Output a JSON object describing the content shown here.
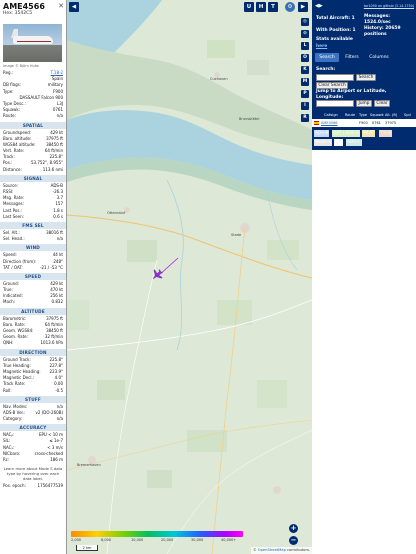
{
  "aircraft": {
    "callsign": "AME4566",
    "hex_label": "Hex: 3542C5",
    "close": "✕",
    "photo_credit": "Image © Björn Huke",
    "info_rows": [
      {
        "k": "Reg.:",
        "v": "T.18-2",
        "link": true
      },
      {
        "k": "",
        "v": "Spain"
      },
      {
        "k": "DB flags:",
        "v": "military"
      },
      {
        "k": "Type:",
        "v": "F900"
      },
      {
        "k": "",
        "v": "DASSAULT Falcon 900"
      },
      {
        "k": "Type Desc.:",
        "v": "L3J"
      },
      {
        "k": "Squawk:",
        "v": "0761"
      },
      {
        "k": "Route:",
        "v": "n/a"
      }
    ]
  },
  "sections": [
    {
      "title": "SPATIAL",
      "rows": [
        {
          "k": "Groundspeed:",
          "v": "429 kt"
        },
        {
          "k": "Baro. altitude:",
          "v": "37975 ft"
        },
        {
          "k": "WGS84 altitude:",
          "v": "38450 ft"
        },
        {
          "k": "Vert. Rate:",
          "v": "64 ft/min"
        },
        {
          "k": "Track:",
          "v": "225.8°"
        },
        {
          "k": "Pos.:",
          "v": "53.752°, 8.955°"
        },
        {
          "k": "Distance:",
          "v": "113.6 nmi"
        }
      ]
    },
    {
      "title": "SIGNAL",
      "rows": [
        {
          "k": "Source:",
          "v": "ADS-B"
        },
        {
          "k": "RSSI:",
          "v": "-26.3"
        },
        {
          "k": "Msg. Rate:",
          "v": "3.7"
        },
        {
          "k": "Messages:",
          "v": "157"
        },
        {
          "k": "Last Pos.:",
          "v": "1.8 s"
        },
        {
          "k": "Last Seen:",
          "v": "0.6 s"
        }
      ]
    },
    {
      "title": "FMS SEL",
      "rows": [
        {
          "k": "Sel. Alt.:",
          "v": "38016 ft"
        },
        {
          "k": "Sel. Head.:",
          "v": "n/a"
        }
      ]
    },
    {
      "title": "WIND",
      "rows": [
        {
          "k": "Speed:",
          "v": "44 kt"
        },
        {
          "k": "Direction (from):",
          "v": "248°"
        },
        {
          "k": "TAT / OAT:",
          "v": "-21 / -53 °C"
        }
      ]
    },
    {
      "title": "SPEED",
      "rows": [
        {
          "k": "Ground:",
          "v": "429 kt"
        },
        {
          "k": "True:",
          "v": "470 kt"
        },
        {
          "k": "Indicated:",
          "v": "256 kt"
        },
        {
          "k": "Mach:",
          "v": "0.832"
        }
      ]
    },
    {
      "title": "ALTITUDE",
      "rows": [
        {
          "k": "Barometric:",
          "v": "37975 ft"
        },
        {
          "k": "Baro. Rate:",
          "v": "64 ft/min"
        },
        {
          "k": "Geom. WGS84:",
          "v": "38450 ft"
        },
        {
          "k": "Geom. Rate:",
          "v": "32 ft/min"
        },
        {
          "k": "QNH:",
          "v": "1013.6 hPa"
        }
      ]
    },
    {
      "title": "DIRECTION",
      "rows": [
        {
          "k": "Ground Track:",
          "v": "225.8°"
        },
        {
          "k": "True Heading:",
          "v": "227.8°"
        },
        {
          "k": "Magnetic Heading:",
          "v": "223.9°"
        },
        {
          "k": "Magnetic Decl.:",
          "v": "4.0°"
        },
        {
          "k": "Track Rate:",
          "v": "0.00"
        },
        {
          "k": "Roll:",
          "v": "-0.5"
        }
      ]
    },
    {
      "title": "STUFF",
      "rows": [
        {
          "k": "Nav. Modes:",
          "v": "n/a"
        },
        {
          "k": "ADS-B Ver.:",
          "v": "v2 (DO-260B)"
        },
        {
          "k": "Category:",
          "v": "n/a"
        }
      ]
    },
    {
      "title": "ACCURACY",
      "rows": [
        {
          "k": "NACₚ:",
          "v": "EPU < 10 m"
        },
        {
          "k": "SIL:",
          "v": "≤ 1e-7"
        },
        {
          "k": "NACᵥ:",
          "v": "< 3 m/s"
        },
        {
          "k": "NICbaro:",
          "v": "cross-checked"
        },
        {
          "k": "Rc:",
          "v": "186 m"
        }
      ]
    }
  ],
  "learn_more": "Learn more about Mode S data type by hovering over each data label.",
  "pos_epoch": {
    "k": "Pos. epoch:",
    "v": "1756477539"
  },
  "map": {
    "top_buttons": [
      "◀",
      "U",
      "H",
      "T"
    ],
    "side_buttons": [
      "◎",
      "⊙",
      "L",
      "O",
      "K",
      "M",
      "P",
      "I",
      "R"
    ],
    "zoom_in": "+",
    "zoom_out": "−",
    "legend_ticks": [
      "2,000",
      "6,000",
      "10,000",
      "20,000",
      "30,000",
      "40,000+"
    ],
    "scale": "2 km",
    "osm_prefix": "© ",
    "osm_link": "OpenStreetMap",
    "osm_suffix": " contributors.",
    "place_labels": [
      "Cuxhaven",
      "Otterndorf",
      "Stade",
      "Brunsbüttel",
      "Bremerhaven"
    ]
  },
  "right": {
    "collapse": "◀▶",
    "github_link": "tar1090 on github (3.14.1750)",
    "total_aircraft": "Total Aircraft: 1",
    "with_position": "With Position: 1",
    "stats_available": "Stats available",
    "messages": "Messages: 1524.0/sec",
    "history": "History: 20659 positions",
    "stats_link": "here",
    "tabs": [
      "Search",
      "Filters",
      "Columns"
    ],
    "search_label": "Search:",
    "search_btn": "Search",
    "clear_search": "Clear Search",
    "jump_label": "Jump to Airport or Latitude, Longitude:",
    "jump_btn": "Jump",
    "clear_btn": "Clear",
    "columns": [
      "Callsign",
      "Route",
      "Type",
      "Squawk",
      "Alt. (ft)",
      "Spd"
    ],
    "row": {
      "callsign": "AME4566",
      "type": "F900",
      "squawk": "0761",
      "alt": "37975"
    },
    "sources": [
      {
        "label": "ADS-B",
        "bg": "#c8d9f5"
      },
      {
        "label": "UAT / ADS-R",
        "bg": "#d8f0c6"
      },
      {
        "label": "MLAT",
        "bg": "#f2e6b0"
      },
      {
        "label": "TIS-B",
        "bg": "#f5d5c6"
      },
      {
        "label": "Mode-S",
        "bg": "#e6e6e6"
      },
      {
        "label": "AIS",
        "bg": "#ffffff"
      },
      {
        "label": "ADS-C",
        "bg": "#c9ebe3"
      }
    ]
  },
  "colors": {
    "panel_navy": "#002c6f",
    "section_text": "#1d4f8a",
    "aircraft_icon": "#a020f0",
    "water": "#aad3df"
  }
}
